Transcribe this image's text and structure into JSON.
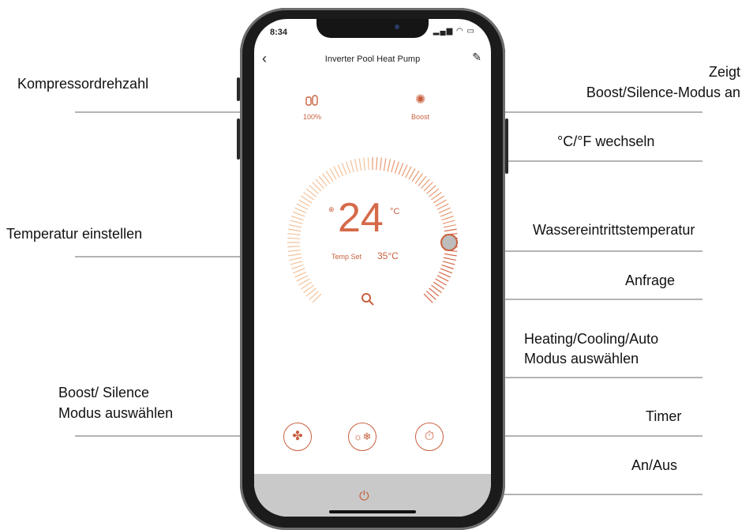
{
  "annotations": {
    "compressor_speed": "Kompressordrehzahl",
    "shows_mode_line1": "Zeigt",
    "shows_mode_line2": "Boost/Silence-Modus an",
    "unit_switch": "°C/°F  wechseln",
    "set_temperature": "Temperatur einstellen",
    "water_inlet_temperature": "Wassereintrittstemperatur",
    "query": "Anfrage",
    "mode_select_line1": "Heating/Cooling/Auto",
    "mode_select_line2": "Modus  auswählen",
    "boost_select_line1": "Boost/ Silence",
    "boost_select_line2": "Modus auswählen",
    "timer": "Timer",
    "on_off": "An/Aus"
  },
  "phone": {
    "status_time": "8:34",
    "title": "Inverter Pool Heat Pump",
    "compressor_value": "100%",
    "mode_value": "Boost",
    "water_temp": "24",
    "unit": "°C",
    "temp_set_label": "Temp Set",
    "temp_set_value": "35°C"
  },
  "icons": {
    "compressor": "compressor-icon",
    "boost": "fan-icon",
    "query": "search-icon",
    "fan_button": "fan-icon",
    "mode_button": "sun-snowflake-icon",
    "timer_button": "stopwatch-icon",
    "power": "power-icon"
  },
  "colors": {
    "accent": "#c8603e",
    "bar": "#c9c9c9"
  }
}
